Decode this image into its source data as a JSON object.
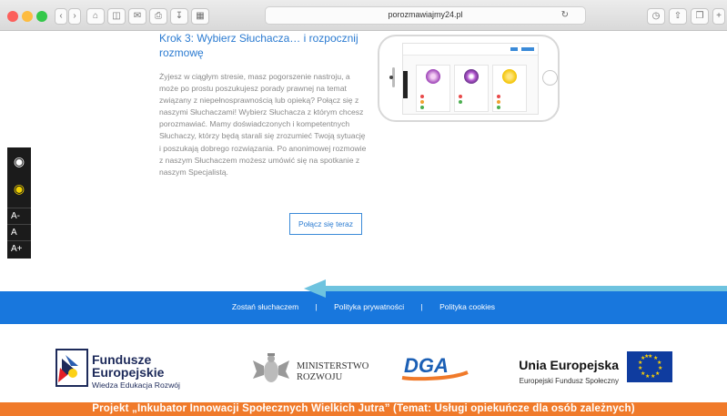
{
  "browser": {
    "url": "porozmawiajmy24.pl"
  },
  "step": {
    "title": "Krok 3: Wybierz Słuchacza… i rozpocznij rozmowę",
    "paragraph1": "Żyjesz w ciągłym stresie, masz pogorszenie nastroju, a może po prostu poszukujesz porady prawnej na temat związany z niepełnosprawnością lub opieką? Połącz się z naszymi Słuchaczami! Wybierz Słuchacza z którym chcesz porozmawiać. Mamy doświadczonych i kompetentnych Słuchaczy, którzy będą starali się zrozumieć Twoją sytuację i poszukają dobrego rozwiązania.",
    "paragraph2": "Po anonimowej rozmowie z naszym Słuchaczem możesz umówić się na spotkanie z naszym Specjalistą.",
    "button": "Połącz się teraz"
  },
  "accessibility": {
    "font_minus": "A-",
    "font_normal": "A",
    "font_plus": "A+",
    "contrast_icon": "eye-icon",
    "contrast_yellow_icon": "eye-yellow-icon"
  },
  "footer_links": {
    "become_listener": "Zostań słuchaczem",
    "privacy": "Polityka prywatności",
    "cookies": "Polityka cookies",
    "separator": "|"
  },
  "logos": {
    "fe_line1": "Fundusze",
    "fe_line2": "Europejskie",
    "fe_sub": "Wiedza Edukacja Rozwój",
    "ministry_line1": "MINISTERSTWO",
    "ministry_line2": "ROZWOJU",
    "dga": "DGA",
    "ue_title": "Unia Europejska",
    "ue_sub": "Europejski Fundusz Społeczny"
  },
  "project_banner": "Projekt „Inkubator Innowacji Społecznych Wielkich Jutra” (Temat: Usługi opiekuńcze dla osób zależnych)",
  "colors": {
    "accent": "#2b7bd1",
    "footer_blue": "#1877dd",
    "arrow": "#6ec3df",
    "banner_orange": "#f07a2a"
  }
}
